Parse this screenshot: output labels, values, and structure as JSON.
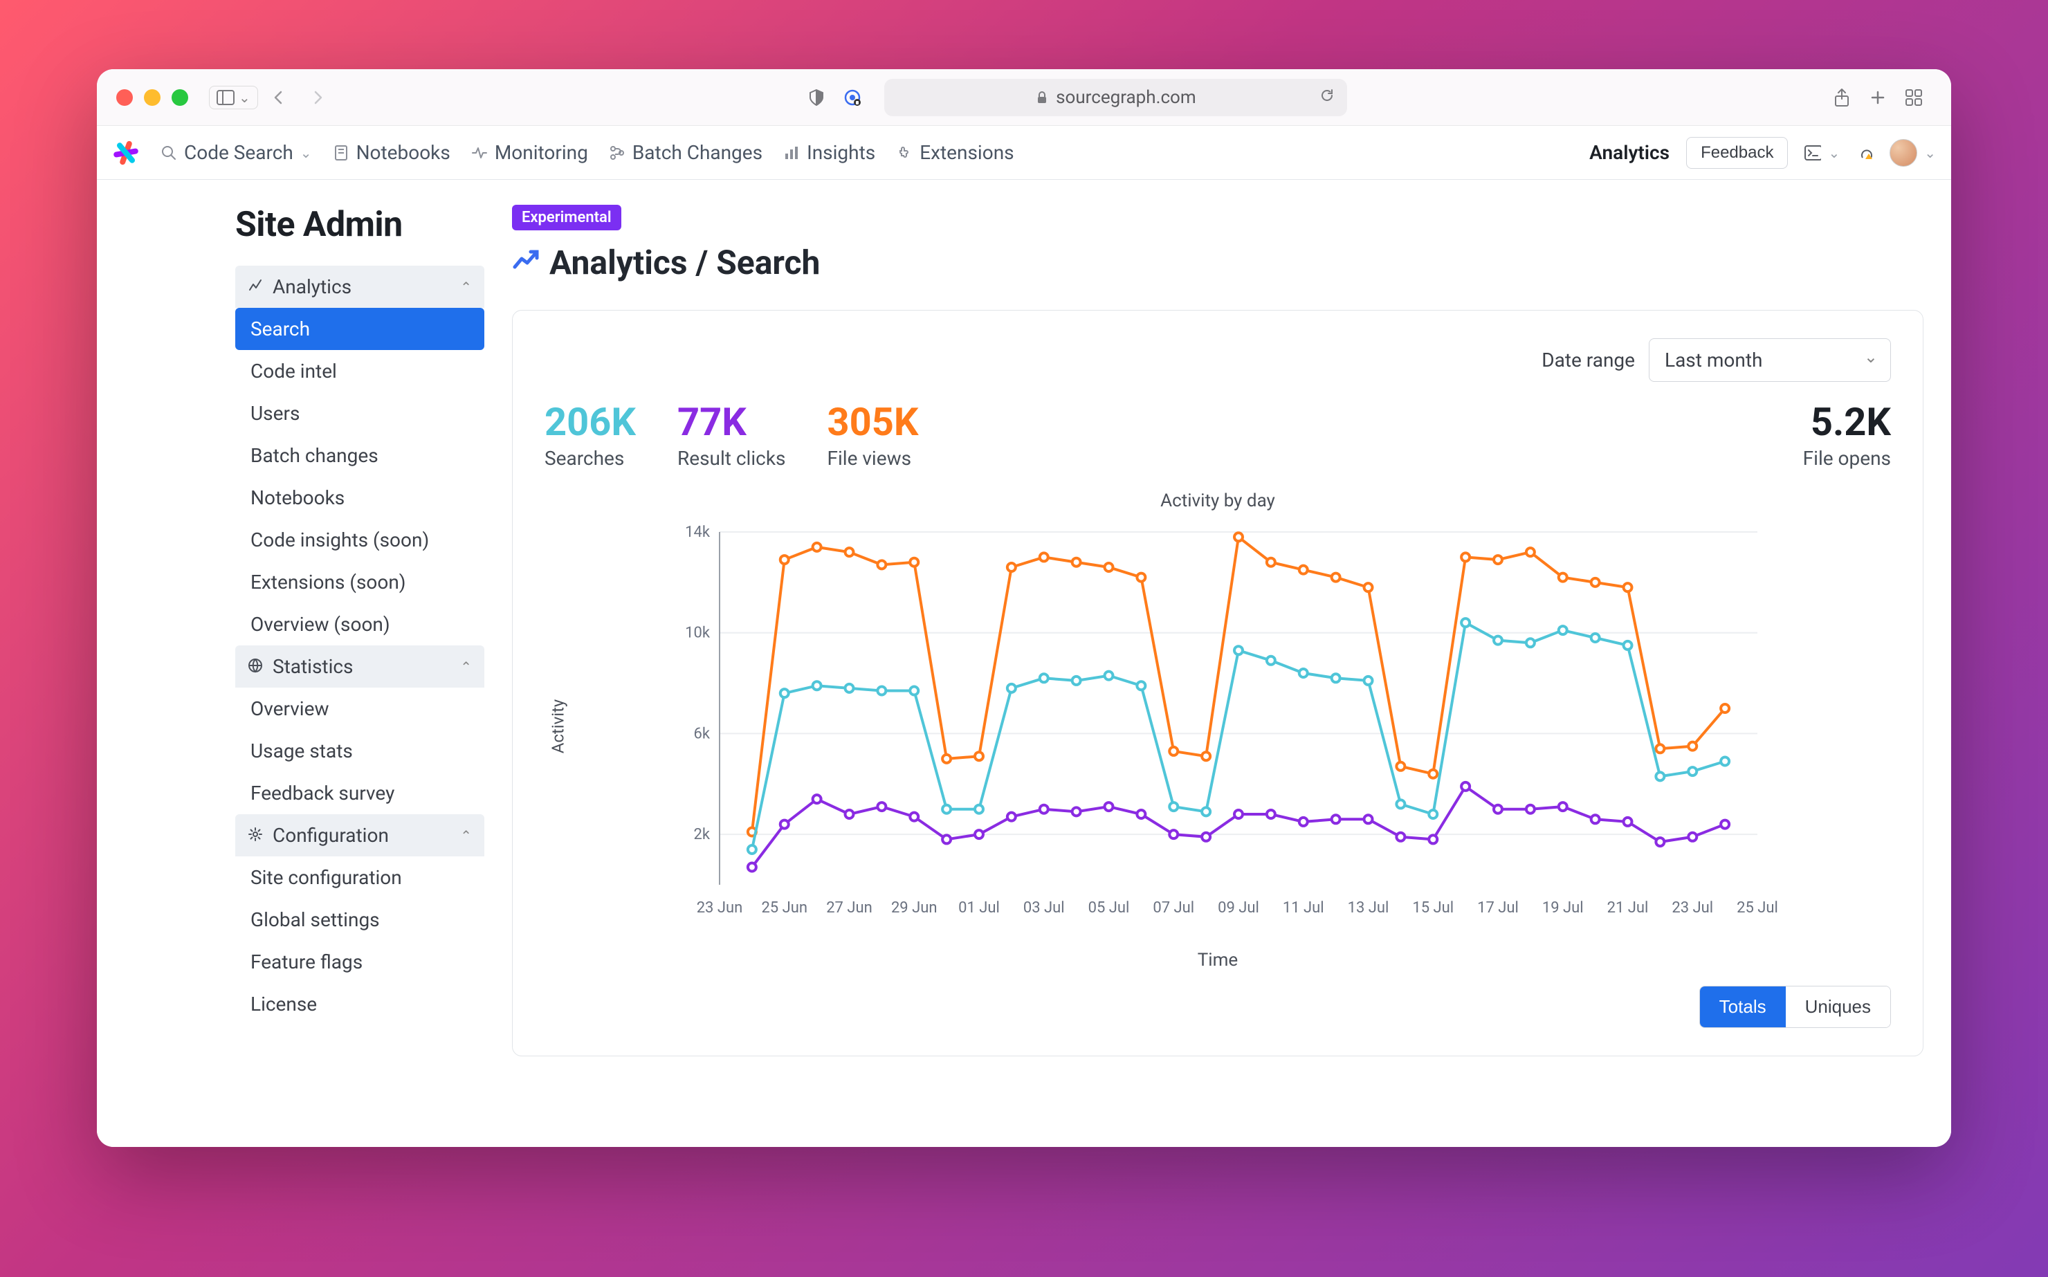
{
  "browser": {
    "url_host": "sourcegraph.com"
  },
  "topnav": {
    "items": [
      {
        "label": "Code Search",
        "has_caret": true
      },
      {
        "label": "Notebooks"
      },
      {
        "label": "Monitoring"
      },
      {
        "label": "Batch Changes"
      },
      {
        "label": "Insights"
      },
      {
        "label": "Extensions"
      }
    ],
    "right": {
      "analytics": "Analytics",
      "feedback": "Feedback"
    }
  },
  "page": {
    "admin_title": "Site Admin",
    "badge": "Experimental",
    "heading": "Analytics / Search"
  },
  "sidebar": {
    "sections": [
      {
        "title": "Analytics",
        "items": [
          "Search",
          "Code intel",
          "Users",
          "Batch changes",
          "Notebooks",
          "Code insights (soon)",
          "Extensions (soon)",
          "Overview (soon)"
        ],
        "active": 0
      },
      {
        "title": "Statistics",
        "items": [
          "Overview",
          "Usage stats",
          "Feedback survey"
        ]
      },
      {
        "title": "Configuration",
        "items": [
          "Site configuration",
          "Global settings",
          "Feature flags",
          "License"
        ]
      }
    ]
  },
  "filters": {
    "date_label": "Date range",
    "date_value": "Last month"
  },
  "summary": {
    "searches": {
      "value": "206K",
      "label": "Searches"
    },
    "clicks": {
      "value": "77K",
      "label": "Result clicks"
    },
    "views": {
      "value": "305K",
      "label": "File views"
    },
    "opens": {
      "value": "5.2K",
      "label": "File opens"
    }
  },
  "toggle": {
    "totals": "Totals",
    "uniques": "Uniques",
    "active": "totals"
  },
  "chart_data": {
    "type": "line",
    "title": "Activity by day",
    "xlabel": "Time",
    "ylabel": "Activity",
    "ylim": [
      0,
      14000
    ],
    "yticks": [
      2000,
      6000,
      10000,
      14000
    ],
    "ytick_labels": [
      "2k",
      "6k",
      "10k",
      "14k"
    ],
    "xtick_labels": [
      "23 Jun",
      "25 Jun",
      "27 Jun",
      "29 Jun",
      "01 Jul",
      "03 Jul",
      "05 Jul",
      "07 Jul",
      "09 Jul",
      "11 Jul",
      "13 Jul",
      "15 Jul",
      "17 Jul",
      "19 Jul",
      "21 Jul",
      "23 Jul",
      "25 Jul"
    ],
    "x_start": "25 Jun",
    "x": [
      0,
      1,
      2,
      3,
      4,
      5,
      6,
      7,
      8,
      9,
      10,
      11,
      12,
      13,
      14,
      15,
      16,
      17,
      18,
      19,
      20,
      21,
      22,
      23,
      24,
      25,
      26,
      27,
      28,
      29,
      30
    ],
    "series": [
      {
        "name": "File views",
        "color": "#ff7b1a",
        "values": [
          2100,
          12900,
          13400,
          13200,
          12700,
          12800,
          5000,
          5100,
          12600,
          13000,
          12800,
          12600,
          12200,
          5300,
          5100,
          13800,
          12800,
          12500,
          12200,
          11800,
          4700,
          4400,
          13000,
          12900,
          13200,
          12200,
          12000,
          11800,
          5400,
          5500,
          7000
        ]
      },
      {
        "name": "Searches",
        "color": "#4fc5d8",
        "values": [
          1400,
          7600,
          7900,
          7800,
          7700,
          7700,
          3000,
          3000,
          7800,
          8200,
          8100,
          8300,
          7900,
          3100,
          2900,
          9300,
          8900,
          8400,
          8200,
          8100,
          3200,
          2800,
          10400,
          9700,
          9600,
          10100,
          9800,
          9500,
          4300,
          4500,
          4900
        ]
      },
      {
        "name": "Result clicks",
        "color": "#8a2be2",
        "values": [
          700,
          2400,
          3400,
          2800,
          3100,
          2700,
          1800,
          2000,
          2700,
          3000,
          2900,
          3100,
          2800,
          2000,
          1900,
          2800,
          2800,
          2500,
          2600,
          2600,
          1900,
          1800,
          3900,
          3000,
          3000,
          3100,
          2600,
          2500,
          1700,
          1900,
          2400
        ]
      }
    ]
  }
}
